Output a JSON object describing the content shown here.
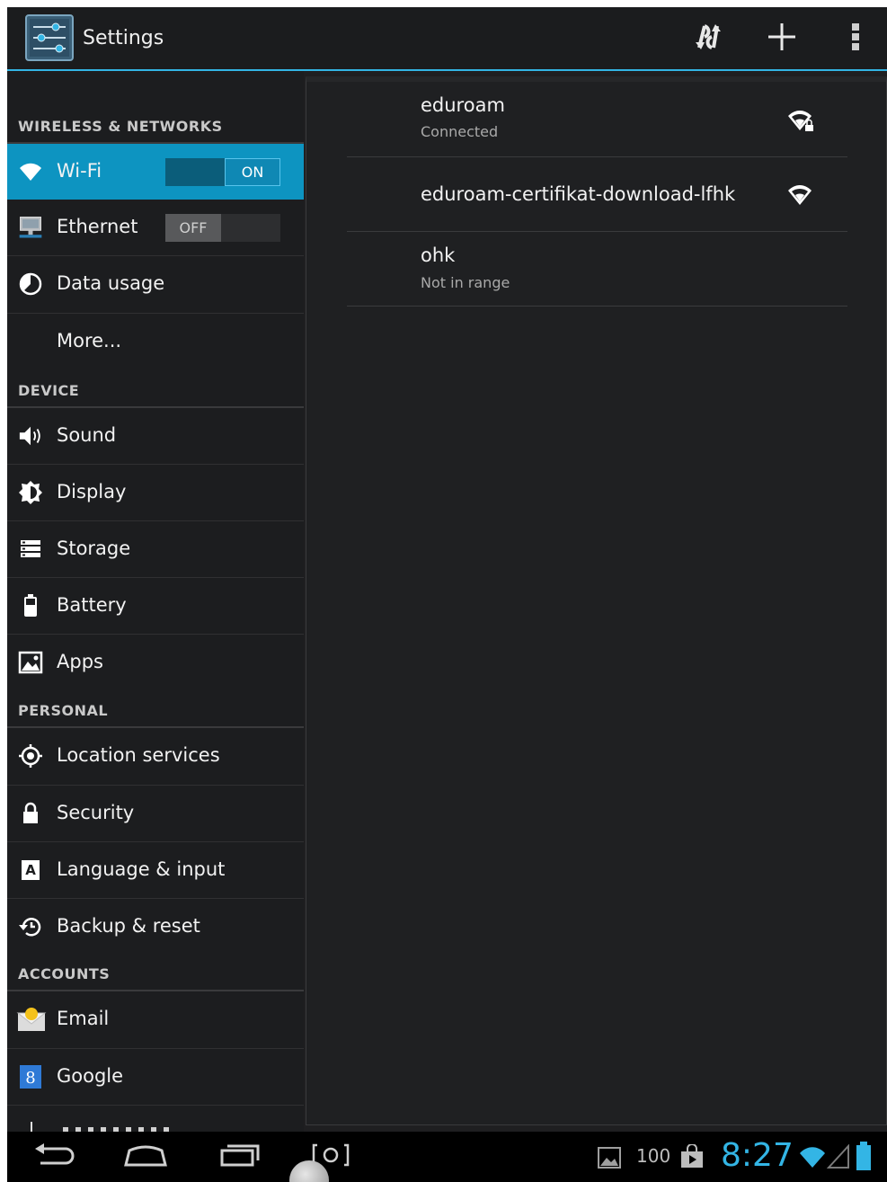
{
  "app": {
    "title": "Settings"
  },
  "actionbar": {
    "icons": [
      "settings-app-icon",
      "scan-refresh-icon",
      "add-icon",
      "overflow-menu-icon"
    ]
  },
  "sections": {
    "wireless": "WIRELESS & NETWORKS",
    "device": "DEVICE",
    "personal": "PERSONAL",
    "accounts": "ACCOUNTS"
  },
  "items": {
    "wifi": {
      "label": "Wi-Fi",
      "toggle": "ON",
      "icon": "wifi-icon"
    },
    "ethernet": {
      "label": "Ethernet",
      "toggle": "OFF",
      "icon": "ethernet-icon"
    },
    "data_usage": {
      "label": "Data usage",
      "icon": "data-usage-icon"
    },
    "more": {
      "label": "More..."
    },
    "sound": {
      "label": "Sound",
      "icon": "speaker-icon"
    },
    "display": {
      "label": "Display",
      "icon": "brightness-icon"
    },
    "storage": {
      "label": "Storage",
      "icon": "storage-icon"
    },
    "battery": {
      "label": "Battery",
      "icon": "battery-icon"
    },
    "apps": {
      "label": "Apps",
      "icon": "apps-icon"
    },
    "location": {
      "label": "Location services",
      "icon": "location-icon"
    },
    "security": {
      "label": "Security",
      "icon": "lock-icon"
    },
    "language": {
      "label": "Language & input",
      "icon": "keyboard-icon"
    },
    "backup": {
      "label": "Backup & reset",
      "icon": "backup-icon"
    },
    "email": {
      "label": "Email",
      "icon": "email-icon"
    },
    "google": {
      "label": "Google",
      "icon": "google-icon"
    }
  },
  "networks": [
    {
      "name": "eduroam",
      "status": "Connected",
      "secured": true
    },
    {
      "name": "eduroam-certifikat-download-lfhk",
      "status": "",
      "secured": false
    },
    {
      "name": "ohk",
      "status": "Not in range",
      "secured": false
    }
  ],
  "statusbar": {
    "battery_percent": "100",
    "time": "8:27"
  },
  "colors": {
    "accent": "#33b5e5",
    "selected": "#0d94c1",
    "background": "#1f1f21"
  }
}
